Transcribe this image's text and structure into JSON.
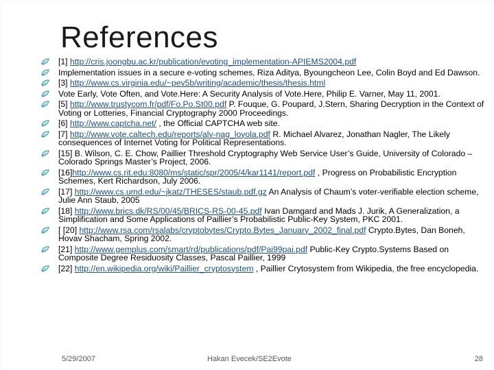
{
  "title": "References",
  "refs": [
    {
      "parts": [
        {
          "t": "[1] "
        },
        {
          "t": "http://cris.joongbu.ac.kr/publication/evoting_implementation-APIEMS2004.pdf",
          "link": true
        }
      ]
    },
    {
      "parts": [
        {
          "t": "Implementation issues in a secure e-voting schemes, Riza Aditya, Byoungcheon Lee, Colin Boyd and Ed Dawson."
        }
      ]
    },
    {
      "parts": [
        {
          "t": " [3] "
        },
        {
          "t": "http://www.cs.virginia.edu/~pev5b/writing/academic/thesis/thesis.html",
          "link": true
        }
      ]
    },
    {
      "parts": [
        {
          "t": "Vote Early, Vote Often, and Vote.Here: A Security Analysis of Vote.Here, Philip E. Varner, May 11, 2001."
        }
      ]
    },
    {
      "parts": [
        {
          "t": " [5] "
        },
        {
          "t": "http://www.trustycom.fr/pdf/Fo.Po.St00.pdf",
          "link": true
        },
        {
          "t": " P. Fouque, G. Poupard, J.Stern, Sharing Decryption in the Context of Voting or Lotteries, Financial Cryptography 2000 Proceedings."
        }
      ]
    },
    {
      "parts": [
        {
          "t": "[6] "
        },
        {
          "t": "http://www.captcha.net/",
          "link": true
        },
        {
          "t": " , the Official CAPTCHA web site."
        }
      ]
    },
    {
      "parts": [
        {
          "t": "[7] "
        },
        {
          "t": "http://www.vote.caltech.edu/reports/alv-nag_loyola.pdf",
          "link": true
        },
        {
          "t": " R. Michael Alvarez, Jonathan Nagler, The Likely consequences of Internet Voting for Political Representations."
        }
      ]
    },
    {
      "parts": [
        {
          "t": " [15] B. Wilson, C. E. Chow, Paillier Threshold Cryptography Web Service User’s Guide,  University of Colorado – Colorado Springs Master’s Project, 2006."
        }
      ]
    },
    {
      "parts": [
        {
          "t": "[16]"
        },
        {
          "t": "http://www.cs.rit.edu:8080/ms/static/spr/2005/4/kar1141/report.pdf",
          "link": true
        },
        {
          "t": " , Progress on Probabilistic Encryption Schemes, Kert Richardson, July 2006."
        }
      ]
    },
    {
      "parts": [
        {
          "t": "[17] "
        },
        {
          "t": "http://www.cs.umd.edu/~jkatz/THESES/staub.pdf.gz",
          "link": true
        },
        {
          "t": " An Analysis of Chaum’s voter-verifiable election scheme, Julie Ann Staub, 2005"
        }
      ]
    },
    {
      "parts": [
        {
          "t": "[18] "
        },
        {
          "t": "http://www.brics.dk/RS/00/45/BRICS-RS-00-45.pdf",
          "link": true
        },
        {
          "t": " Ivan Damgard and  Mads J. Jurik, A Generalization, a Simplification and Some Applications of Paillier’s Probabilistic Public-Key System, PKC 2001."
        }
      ]
    },
    {
      "parts": [
        {
          "t": "[ [20] "
        },
        {
          "t": "http://www.rsa.com/rsalabs/cryptobytes/Crypto.Bytes_January_2002_final.pdf",
          "link": true
        },
        {
          "t": "  Crypto.Bytes, Dan Boneh, Hovav Shacham, Spring 2002."
        }
      ]
    },
    {
      "parts": [
        {
          "t": "[21] "
        },
        {
          "t": "http://www.gemplus.com/smart/rd/publications/pdf/Pai99pai.pdf",
          "link": true
        },
        {
          "t": "  Public-Key Crypto.Systems Based on Composite Degree Residuosity Classes, Pascal Paillier, 1999"
        }
      ]
    },
    {
      "parts": [
        {
          "t": "[22] "
        },
        {
          "t": "http://en.wikipedia.org/wiki/Paillier_cryptosystem",
          "link": true
        },
        {
          "t": " , Paillier Crytosystem from Wikipedia, the free encyclopedia."
        }
      ]
    }
  ],
  "footer": {
    "date": "5/29/2007",
    "author": "Hakan Evecek/SE2Evote",
    "page": "28"
  },
  "icons": {
    "bullet": "leaf-bullet-icon"
  },
  "colors": {
    "accent": "#3c9aa8",
    "link": "#1f4e79"
  }
}
